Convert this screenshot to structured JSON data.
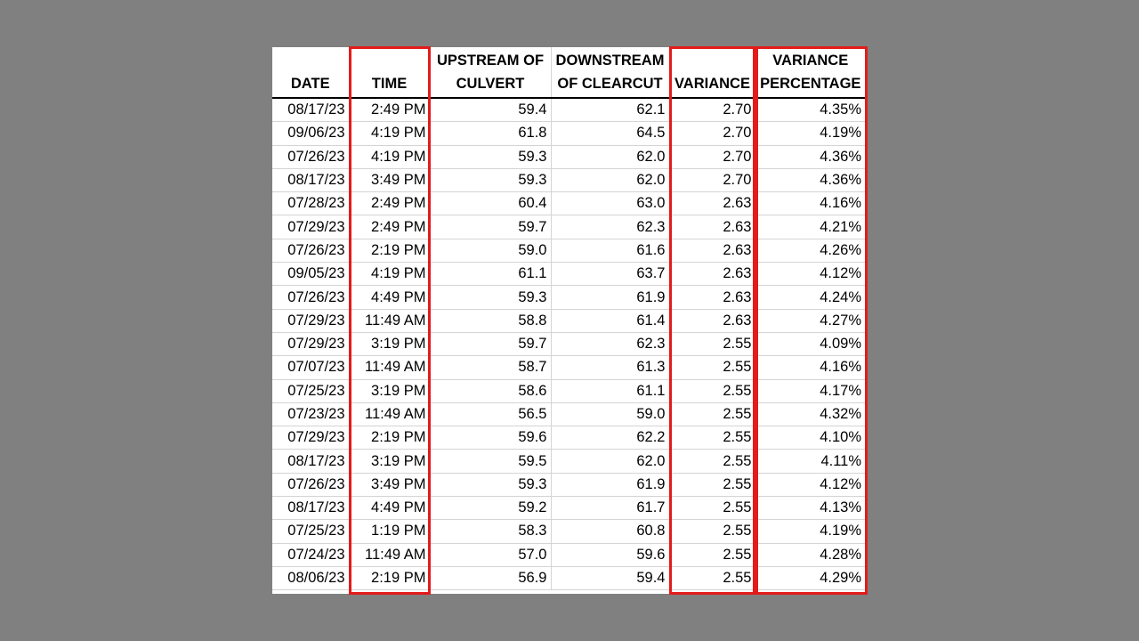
{
  "table": {
    "headers": {
      "date": [
        "",
        "DATE"
      ],
      "time": [
        "",
        "TIME"
      ],
      "upstream": [
        "UPSTREAM OF",
        "CULVERT"
      ],
      "downstream": [
        "DOWNSTREAM",
        "OF CLEARCUT"
      ],
      "variance": [
        "",
        "VARIANCE"
      ],
      "variance_pct": [
        "VARIANCE",
        "PERCENTAGE"
      ]
    },
    "rows": [
      [
        "08/17/23",
        "2:49 PM",
        "59.4",
        "62.1",
        "2.70",
        "4.35%"
      ],
      [
        "09/06/23",
        "4:19 PM",
        "61.8",
        "64.5",
        "2.70",
        "4.19%"
      ],
      [
        "07/26/23",
        "4:19 PM",
        "59.3",
        "62.0",
        "2.70",
        "4.36%"
      ],
      [
        "08/17/23",
        "3:49 PM",
        "59.3",
        "62.0",
        "2.70",
        "4.36%"
      ],
      [
        "07/28/23",
        "2:49 PM",
        "60.4",
        "63.0",
        "2.63",
        "4.16%"
      ],
      [
        "07/29/23",
        "2:49 PM",
        "59.7",
        "62.3",
        "2.63",
        "4.21%"
      ],
      [
        "07/26/23",
        "2:19 PM",
        "59.0",
        "61.6",
        "2.63",
        "4.26%"
      ],
      [
        "09/05/23",
        "4:19 PM",
        "61.1",
        "63.7",
        "2.63",
        "4.12%"
      ],
      [
        "07/26/23",
        "4:49 PM",
        "59.3",
        "61.9",
        "2.63",
        "4.24%"
      ],
      [
        "07/29/23",
        "11:49 AM",
        "58.8",
        "61.4",
        "2.63",
        "4.27%"
      ],
      [
        "07/29/23",
        "3:19 PM",
        "59.7",
        "62.3",
        "2.55",
        "4.09%"
      ],
      [
        "07/07/23",
        "11:49 AM",
        "58.7",
        "61.3",
        "2.55",
        "4.16%"
      ],
      [
        "07/25/23",
        "3:19 PM",
        "58.6",
        "61.1",
        "2.55",
        "4.17%"
      ],
      [
        "07/23/23",
        "11:49 AM",
        "56.5",
        "59.0",
        "2.55",
        "4.32%"
      ],
      [
        "07/29/23",
        "2:19 PM",
        "59.6",
        "62.2",
        "2.55",
        "4.10%"
      ],
      [
        "08/17/23",
        "3:19 PM",
        "59.5",
        "62.0",
        "2.55",
        "4.11%"
      ],
      [
        "07/26/23",
        "3:49 PM",
        "59.3",
        "61.9",
        "2.55",
        "4.12%"
      ],
      [
        "08/17/23",
        "4:49 PM",
        "59.2",
        "61.7",
        "2.55",
        "4.13%"
      ],
      [
        "07/25/23",
        "1:19 PM",
        "58.3",
        "60.8",
        "2.55",
        "4.19%"
      ],
      [
        "07/24/23",
        "11:49 AM",
        "57.0",
        "59.6",
        "2.55",
        "4.28%"
      ],
      [
        "08/06/23",
        "2:19 PM",
        "56.9",
        "59.4",
        "2.55",
        "4.29%"
      ]
    ]
  },
  "highlight_color": "#e31b1b"
}
